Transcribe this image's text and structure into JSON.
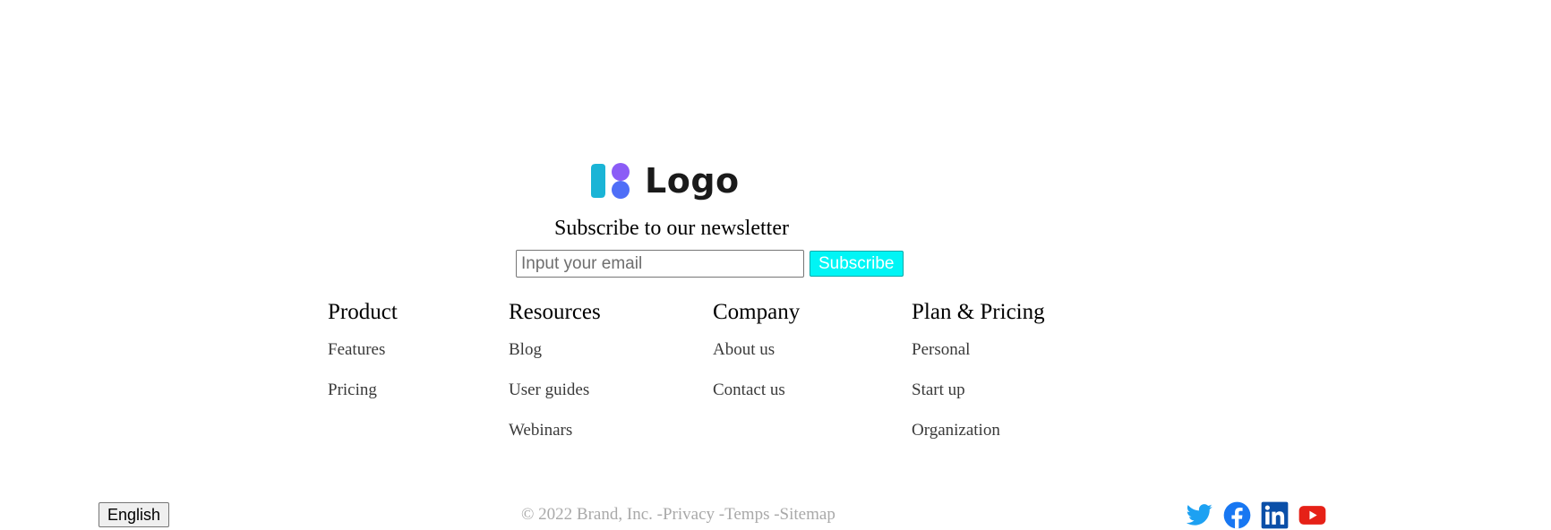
{
  "logo": {
    "text": "Logo",
    "icon": "logo-mark-icon",
    "colors": {
      "bar": "#1ab4d6",
      "dot_top": "#8b5cf6",
      "dot_bottom": "#4f6ef7"
    }
  },
  "newsletter": {
    "title": "Subscribe to our newsletter",
    "email_placeholder": "Input your email",
    "email_value": "",
    "subscribe_label": "Subscribe",
    "subscribe_color": "#00f5f5"
  },
  "columns": [
    {
      "title": "Product",
      "links": [
        "Features",
        "Pricing"
      ]
    },
    {
      "title": "Resources",
      "links": [
        "Blog",
        "User guides",
        "Webinars"
      ]
    },
    {
      "title": "Company",
      "links": [
        "About us",
        "Contact us"
      ]
    },
    {
      "title": "Plan & Pricing",
      "links": [
        "Personal",
        "Start up",
        "Organization"
      ]
    }
  ],
  "footer": {
    "language": "English",
    "copyright": "© 2022 Brand, Inc.",
    "links": [
      "-Privacy",
      "-Temps",
      "-Sitemap"
    ],
    "social": [
      {
        "name": "twitter-icon",
        "color": "#1da1f2"
      },
      {
        "name": "facebook-icon",
        "color": "#1877f2"
      },
      {
        "name": "linkedin-icon",
        "color": "#0a66c2"
      },
      {
        "name": "youtube-icon",
        "color": "#e62117"
      }
    ]
  }
}
